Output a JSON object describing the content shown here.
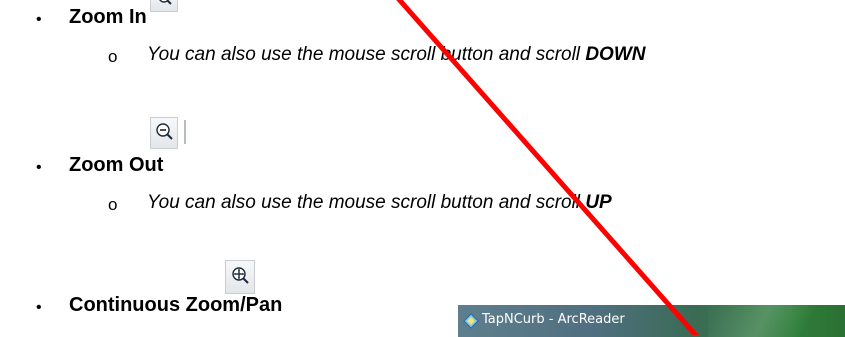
{
  "items": [
    {
      "bullet": "•",
      "label": "Zoom In",
      "icon": "zoom-in-icon",
      "sub": {
        "marker": "o",
        "text_before": "You can also use the mouse scroll button and scroll ",
        "emphasis": "DOWN"
      }
    },
    {
      "bullet": "•",
      "label": "Zoom Out",
      "icon": "zoom-out-icon",
      "sub": {
        "marker": "o",
        "text_before": "You can also use the mouse scroll button and scroll ",
        "emphasis": "UP"
      }
    },
    {
      "bullet": "•",
      "label": "Continuous Zoom/Pan",
      "icon": "continuous-zoom-pan-icon"
    }
  ],
  "window": {
    "title": "TapNCurb - ArcReader",
    "icon": "arcreader-app-icon"
  },
  "annotation": {
    "icon": "red-pointer-line",
    "color": "#ff0000"
  }
}
